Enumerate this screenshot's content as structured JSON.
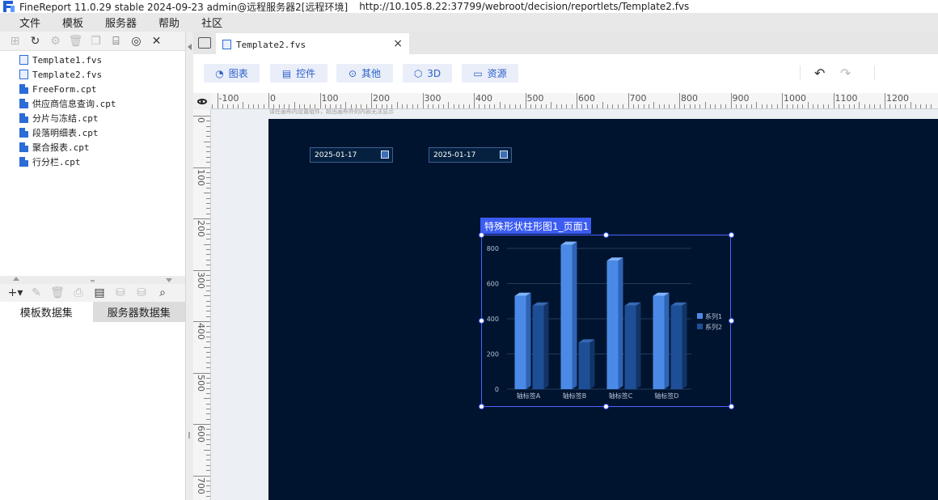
{
  "window": {
    "title": "FineReport 11.0.29 stable 2024-09-23 admin@远程服务器2[远程环境]",
    "url": "http://10.105.8.22:37799/webroot/decision/reportlets/Template2.fvs"
  },
  "menu": [
    "文件",
    "模板",
    "服务器",
    "帮助",
    "社区"
  ],
  "files": [
    {
      "name": "Template1.fvs",
      "kind": "fvs"
    },
    {
      "name": "Template2.fvs",
      "kind": "fvs"
    },
    {
      "name": "FreeForm.cpt",
      "kind": "cpt"
    },
    {
      "name": "供应商信息查询.cpt",
      "kind": "cpt"
    },
    {
      "name": "分片与冻结.cpt",
      "kind": "cpt"
    },
    {
      "name": "段落明细表.cpt",
      "kind": "cpt"
    },
    {
      "name": "聚合报表.cpt",
      "kind": "cpt"
    },
    {
      "name": "行分栏.cpt",
      "kind": "cpt"
    }
  ],
  "dataset_tabs": [
    "模板数据集",
    "服务器数据集"
  ],
  "editor_tab": {
    "label": "Template2.fvs",
    "close": "×"
  },
  "toolbar": {
    "chart": "图表",
    "control": "控件",
    "other": "其他",
    "three_d": "3D",
    "resource": "资源"
  },
  "ruler": {
    "h_labels": [
      "-100",
      "0",
      "100",
      "200",
      "300",
      "400",
      "500",
      "600",
      "700",
      "800",
      "900",
      "1000",
      "1100",
      "1200"
    ],
    "v_labels": [
      "0",
      "100",
      "200",
      "300",
      "400",
      "500",
      "600",
      "700"
    ]
  },
  "canvas": {
    "hint": "请在画布内设置组件，超出画布外的内容无法显示",
    "date1": "2025-01-17",
    "date2": "2025-01-17",
    "background": "#01142f"
  },
  "chart_data": {
    "type": "bar",
    "title": "特殊形状柱形图1_页面1",
    "categories": [
      "轴标签A",
      "轴标签B",
      "轴标签C",
      "轴标签D"
    ],
    "series": [
      {
        "name": "系列1",
        "values": [
          530,
          820,
          730,
          530
        ],
        "color": "#4a8ae6"
      },
      {
        "name": "系列2",
        "values": [
          475,
          265,
          475,
          475
        ],
        "color": "#1e4f96"
      }
    ],
    "ylim": [
      0,
      800
    ],
    "yticks": [
      0,
      200,
      400,
      600,
      800
    ],
    "grid": true,
    "legend": "right"
  }
}
